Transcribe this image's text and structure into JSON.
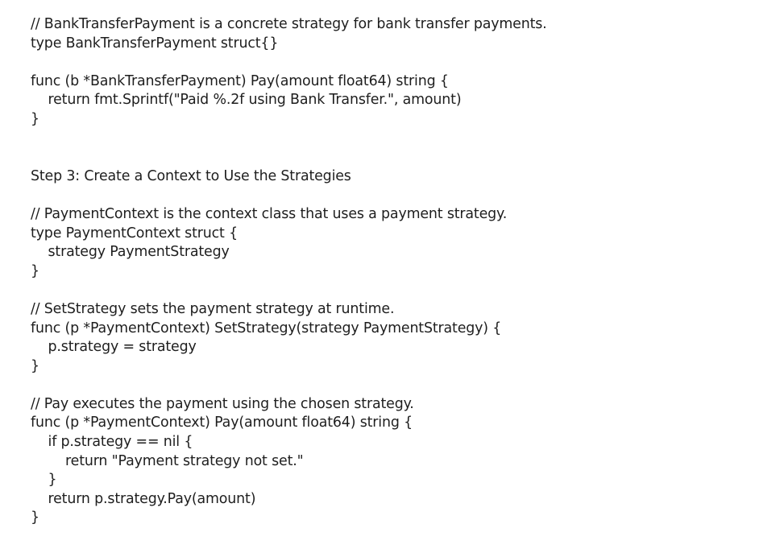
{
  "document": {
    "lines": [
      "// BankTransferPayment is a concrete strategy for bank transfer payments.",
      "type BankTransferPayment struct{}",
      "",
      "func (b *BankTransferPayment) Pay(amount float64) string {",
      "    return fmt.Sprintf(\"Paid %.2f using Bank Transfer.\", amount)",
      "}",
      "",
      "",
      "Step 3: Create a Context to Use the Strategies",
      "",
      "// PaymentContext is the context class that uses a payment strategy.",
      "type PaymentContext struct {",
      "    strategy PaymentStrategy",
      "}",
      "",
      "// SetStrategy sets the payment strategy at runtime.",
      "func (p *PaymentContext) SetStrategy(strategy PaymentStrategy) {",
      "    p.strategy = strategy",
      "}",
      "",
      "// Pay executes the payment using the chosen strategy.",
      "func (p *PaymentContext) Pay(amount float64) string {",
      "    if p.strategy == nil {",
      "        return \"Payment strategy not set.\"",
      "    }",
      "    return p.strategy.Pay(amount)",
      "}"
    ]
  }
}
